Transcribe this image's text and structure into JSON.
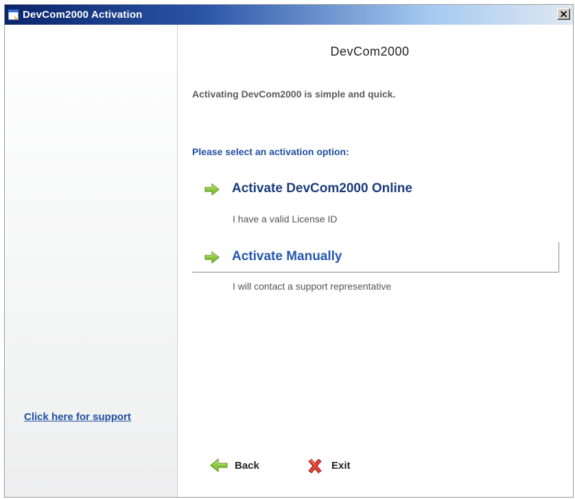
{
  "window": {
    "title": "DevCom2000 Activation",
    "icon": "app-window-icon",
    "close_icon": "close-icon"
  },
  "left_pane": {
    "support_link": "Click here for support"
  },
  "main": {
    "product_name": "DevCom2000",
    "intro": "Activating DevCom2000 is simple and quick.",
    "prompt": "Please select an activation option:",
    "options": [
      {
        "label": "Activate DevCom2000 Online",
        "description": "I have a valid License ID",
        "icon": "green-arrow-right-icon"
      },
      {
        "label": "Activate Manually",
        "description": "I will contact a support representative",
        "icon": "green-arrow-right-icon"
      }
    ]
  },
  "footer": {
    "back_label": "Back",
    "back_icon": "green-arrow-left-icon",
    "exit_label": "Exit",
    "exit_icon": "red-x-icon"
  },
  "colors": {
    "title_bar": "#0a246a",
    "link_blue": "#1f4fa0",
    "arrow_green": "#8cc63f",
    "exit_red": "#e0413a"
  }
}
